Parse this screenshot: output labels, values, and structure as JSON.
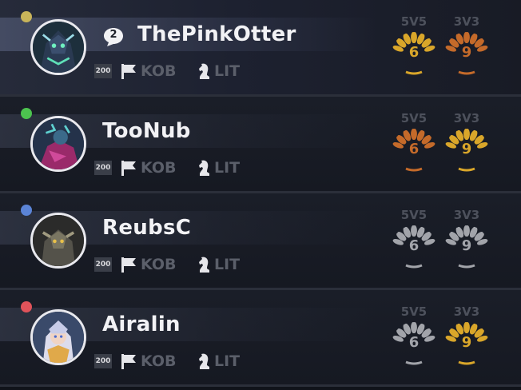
{
  "players": [
    {
      "name": "ThePinkOtter",
      "status_color": "#c8b45a",
      "unread_messages": "2",
      "level": "200",
      "kob_label": "KOB",
      "lit_label": "LIT",
      "modes": [
        {
          "label": "5V5",
          "rank": "6",
          "tier": "gold"
        },
        {
          "label": "3V3",
          "rank": "9",
          "tier": "bronze"
        }
      ]
    },
    {
      "name": "TooNub",
      "status_color": "#4cc34f",
      "level": "200",
      "kob_label": "KOB",
      "lit_label": "LIT",
      "modes": [
        {
          "label": "5V5",
          "rank": "6",
          "tier": "bronze"
        },
        {
          "label": "3V3",
          "rank": "9",
          "tier": "gold"
        }
      ]
    },
    {
      "name": "ReubsC",
      "status_color": "#5b84d6",
      "level": "200",
      "kob_label": "KOB",
      "lit_label": "LIT",
      "modes": [
        {
          "label": "5V5",
          "rank": "6",
          "tier": "silver"
        },
        {
          "label": "3V3",
          "rank": "9",
          "tier": "silver"
        }
      ]
    },
    {
      "name": "Airalin",
      "status_color": "#e0535a",
      "level": "200",
      "kob_label": "KOB",
      "lit_label": "LIT",
      "modes": [
        {
          "label": "5V5",
          "rank": "6",
          "tier": "silver"
        },
        {
          "label": "3V3",
          "rank": "9",
          "tier": "gold"
        }
      ]
    }
  ],
  "tier_colors": {
    "gold": "#d9a62a",
    "bronze": "#c46a2a",
    "silver": "#a2a4aa"
  },
  "icons": {
    "message": "speech-bubble-icon",
    "flag": "flag-icon",
    "knight": "chess-knight-icon"
  }
}
